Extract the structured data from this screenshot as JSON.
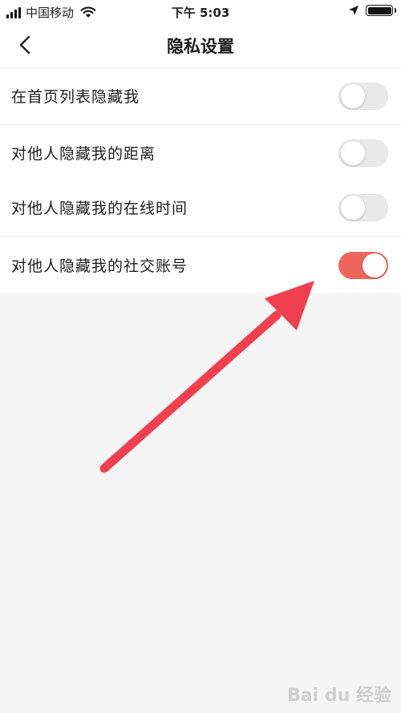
{
  "status_bar": {
    "carrier": "中国移动",
    "time": "下午 5:03",
    "icons": [
      "signal-icon",
      "wifi-icon",
      "location-icon",
      "battery-icon"
    ]
  },
  "nav": {
    "back_icon": "chevron-left-icon",
    "title": "隐私设置"
  },
  "settings": [
    {
      "label": "在首页列表隐藏我",
      "enabled": false
    },
    {
      "label": "对他人隐藏我的距离",
      "enabled": false
    },
    {
      "label": "对他人隐藏我的在线时间",
      "enabled": false
    },
    {
      "label": "对他人隐藏我的社交账号",
      "enabled": true
    }
  ],
  "colors": {
    "toggle_on": "#f0665a",
    "toggle_off": "#e9e9e9",
    "annotation_arrow": "#f0404f",
    "background": "#f5f5f5"
  },
  "watermark": "Bai du 经验"
}
